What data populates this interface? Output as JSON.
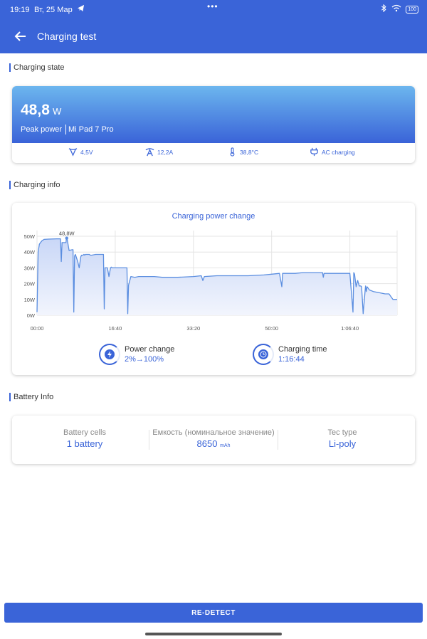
{
  "status_bar": {
    "time": "19:19",
    "date": "Вт, 25 Мар",
    "battery": "100"
  },
  "header": {
    "title": "Charging test"
  },
  "charging_state": {
    "section_title": "Charging state",
    "peak_power_value": "48,8",
    "peak_power_unit": "W",
    "peak_power_label": "Peak power",
    "device": "Mi Pad 7 Pro",
    "voltage": "4,5V",
    "current": "12,2A",
    "temperature": "38,8°C",
    "charger": "AC charging"
  },
  "charging_info": {
    "section_title": "Charging info",
    "power_change_label": "Power change",
    "power_change_value": "2%→100%",
    "charging_time_label": "Charging time",
    "charging_time_value": "1:16:44"
  },
  "chart_data": {
    "type": "area",
    "title": "Charging power change",
    "xlabel": "",
    "ylabel": "",
    "x_ticks": [
      "00:00",
      "16:40",
      "33:20",
      "50:00",
      "1:06:40"
    ],
    "y_ticks": [
      "50W",
      "40W",
      "30W",
      "20W",
      "10W",
      "0W"
    ],
    "xlim_seconds": [
      0,
      4604
    ],
    "ylim": [
      0,
      50
    ],
    "annotation": "48,8W",
    "series": [
      {
        "x": [
          0,
          15,
          30,
          60,
          90,
          150,
          250,
          300,
          310,
          320,
          370,
          375,
          380,
          385,
          410,
          450,
          460,
          470,
          480,
          490,
          520,
          540,
          560,
          570,
          590,
          600,
          610,
          620,
          650,
          660,
          670,
          680,
          700,
          750,
          850,
          860,
          870,
          900,
          920,
          940,
          950,
          960,
          1000,
          1100,
          1150,
          1160,
          1170,
          1200,
          1250,
          1300,
          1500,
          1600,
          1800,
          2000,
          2100,
          2120,
          2140,
          2300,
          2500,
          2700,
          2900,
          3000,
          3100,
          3130,
          3140,
          3150,
          3300,
          3400,
          3500,
          3600,
          3650,
          3660,
          3670,
          3700,
          3800,
          3900,
          4000,
          4040,
          4050,
          4060,
          4080,
          4100,
          4120,
          4140,
          4150,
          4170,
          4200,
          4210,
          4220,
          4250,
          4300,
          4400,
          4450,
          4500,
          4550,
          4604
        ],
        "y": [
          2,
          40,
          45,
          47,
          48,
          48.2,
          48.4,
          48.4,
          34,
          46,
          46,
          48.3,
          48.8,
          48.3,
          41,
          41.5,
          41.5,
          2,
          37.5,
          38.5,
          34,
          30,
          37,
          38,
          38,
          38.5,
          38,
          38.5,
          38.5,
          38.5,
          38.5,
          38,
          38,
          38.5,
          38.5,
          4,
          30,
          30,
          24.5,
          30,
          30.5,
          30,
          30,
          30,
          30,
          1,
          19,
          24.5,
          24,
          24.5,
          24.5,
          24,
          24,
          24.5,
          25,
          22,
          24.5,
          25,
          25,
          25,
          25.5,
          26,
          26.5,
          18,
          26.5,
          26.5,
          26.5,
          27,
          27,
          27,
          27,
          24,
          26.5,
          26.5,
          26.5,
          26.5,
          26.5,
          2,
          27,
          26,
          18,
          22,
          18.5,
          18.5,
          18,
          1,
          18.5,
          15,
          18,
          16,
          15,
          14,
          13.5,
          13.5,
          10,
          10
        ]
      }
    ]
  },
  "battery_info": {
    "section_title": "Battery Info",
    "cells_label": "Battery cells",
    "cells_value": "1 battery",
    "capacity_label": "Емкость (номинальное значение)",
    "capacity_value": "8650",
    "capacity_unit": "mAh",
    "type_label": "Tec type",
    "type_value": "Li-poly"
  },
  "actions": {
    "redetect_label": "RE-DETECT"
  },
  "colors": {
    "accent": "#3a64d8",
    "gradient_top": "#6cb6ee",
    "line": "#5b8ee0",
    "fill": "#dde5fb"
  }
}
